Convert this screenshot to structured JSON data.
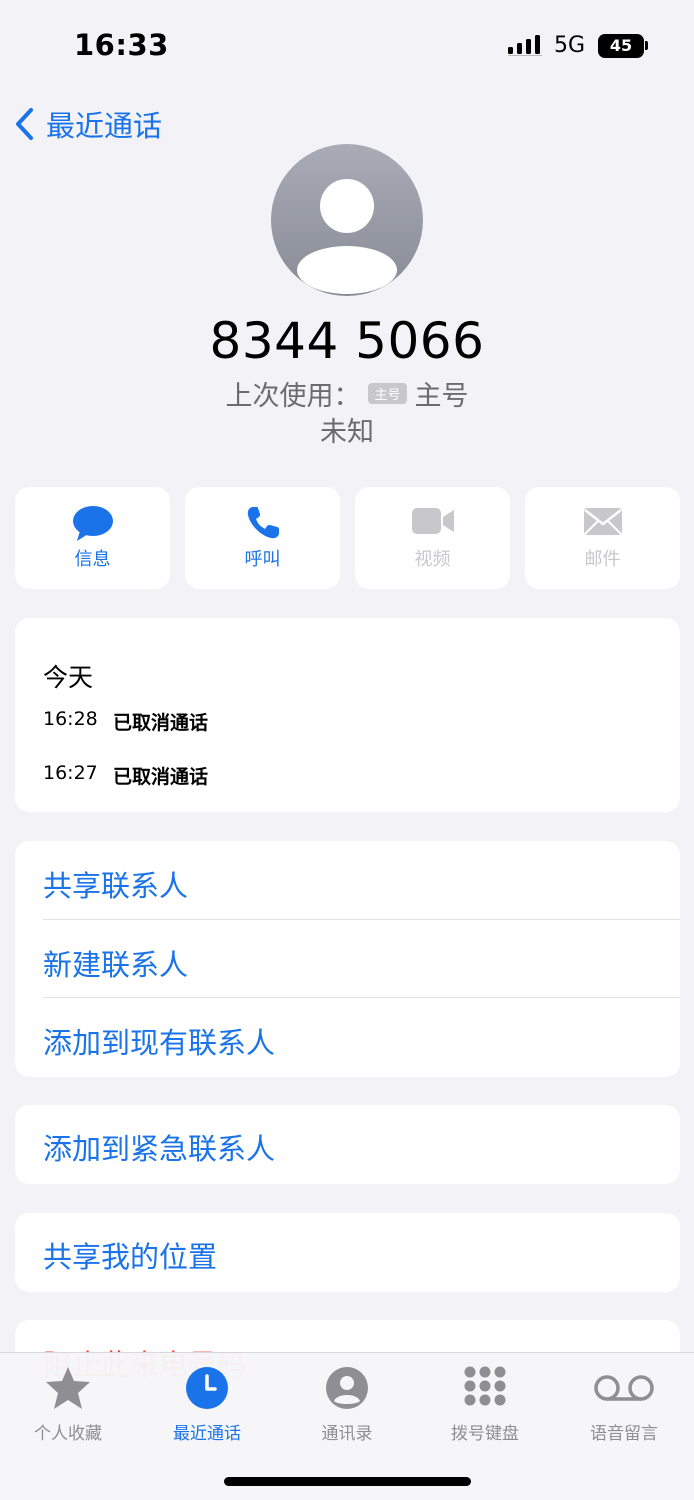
{
  "status": {
    "time": "16:33",
    "network": "5G",
    "battery": "45"
  },
  "nav": {
    "back_label": "最近通话"
  },
  "header": {
    "number": "8344 5066",
    "last_used_label": "上次使用：",
    "sim_tag": "主号",
    "sim_name": "主号",
    "location": "未知"
  },
  "actions": [
    {
      "label": "信息",
      "icon": "message-icon",
      "enabled": true
    },
    {
      "label": "呼叫",
      "icon": "phone-icon",
      "enabled": true
    },
    {
      "label": "视频",
      "icon": "video-icon",
      "enabled": false
    },
    {
      "label": "邮件",
      "icon": "mail-icon",
      "enabled": false
    }
  ],
  "calls": {
    "day": "今天",
    "items": [
      {
        "time": "16:28",
        "status": "已取消通话"
      },
      {
        "time": "16:27",
        "status": "已取消通话"
      }
    ]
  },
  "menu": {
    "share_contact": "共享联系人",
    "new_contact": "新建联系人",
    "add_existing": "添加到现有联系人",
    "add_emergency": "添加到紧急联系人",
    "share_location": "共享我的位置",
    "block_caller": "阻止此来电号码"
  },
  "tabs": [
    {
      "label": "个人收藏",
      "icon": "star-icon",
      "active": false
    },
    {
      "label": "最近通话",
      "icon": "clock-icon",
      "active": true
    },
    {
      "label": "通讯录",
      "icon": "person-icon",
      "active": false
    },
    {
      "label": "拨号键盘",
      "icon": "keypad-icon",
      "active": false
    },
    {
      "label": "语音留言",
      "icon": "voicemail-icon",
      "active": false
    }
  ],
  "colors": {
    "accent": "#1a73e8",
    "destructive": "#ff3b30",
    "background": "#f2f2f7"
  }
}
